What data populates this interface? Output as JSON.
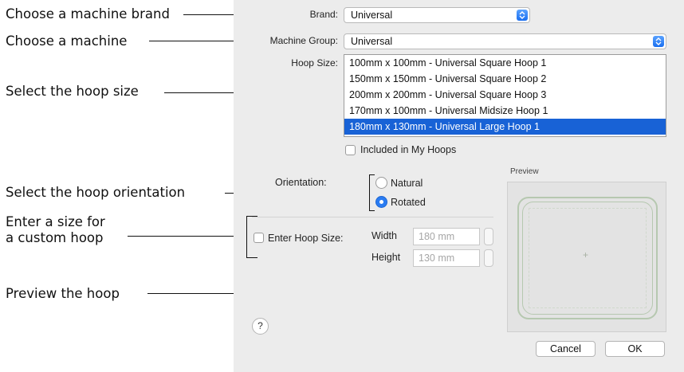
{
  "annotations": {
    "brand": "Choose a machine brand",
    "machine": "Choose a machine",
    "hoop_size": "Select the hoop size",
    "orientation": "Select the hoop orientation",
    "custom_line1": "Enter a size for",
    "custom_line2": "a custom hoop",
    "preview": "Preview the hoop"
  },
  "dialog": {
    "brand_label": "Brand:",
    "brand_value": "Universal",
    "machine_group_label": "Machine Group:",
    "machine_group_value": "Universal",
    "hoop_size_label": "Hoop Size:",
    "hoops": [
      "100mm x 100mm - Universal Square Hoop 1",
      "150mm x 150mm - Universal Square Hoop 2",
      "200mm x 200mm -  Universal Square Hoop 3",
      "170mm x 100mm - Universal Midsize Hoop 1",
      "180mm x 130mm - Universal Large Hoop 1"
    ],
    "selected_hoop_index": 4,
    "included_label": "Included in My Hoops",
    "orientation_label": "Orientation:",
    "natural_label": "Natural",
    "rotated_label": "Rotated",
    "orientation_selected": "Rotated",
    "enter_hoop_size_label": "Enter Hoop Size:",
    "width_label": "Width",
    "width_value": "180 mm",
    "height_label": "Height",
    "height_value": "130 mm",
    "preview_label": "Preview",
    "preview_center": "+",
    "help_label": "?",
    "cancel_label": "Cancel",
    "ok_label": "OK"
  },
  "colors": {
    "selection": "#1862d6",
    "radio_on": "#2a7cf2",
    "hoop_outline": "#b6c8b0"
  }
}
